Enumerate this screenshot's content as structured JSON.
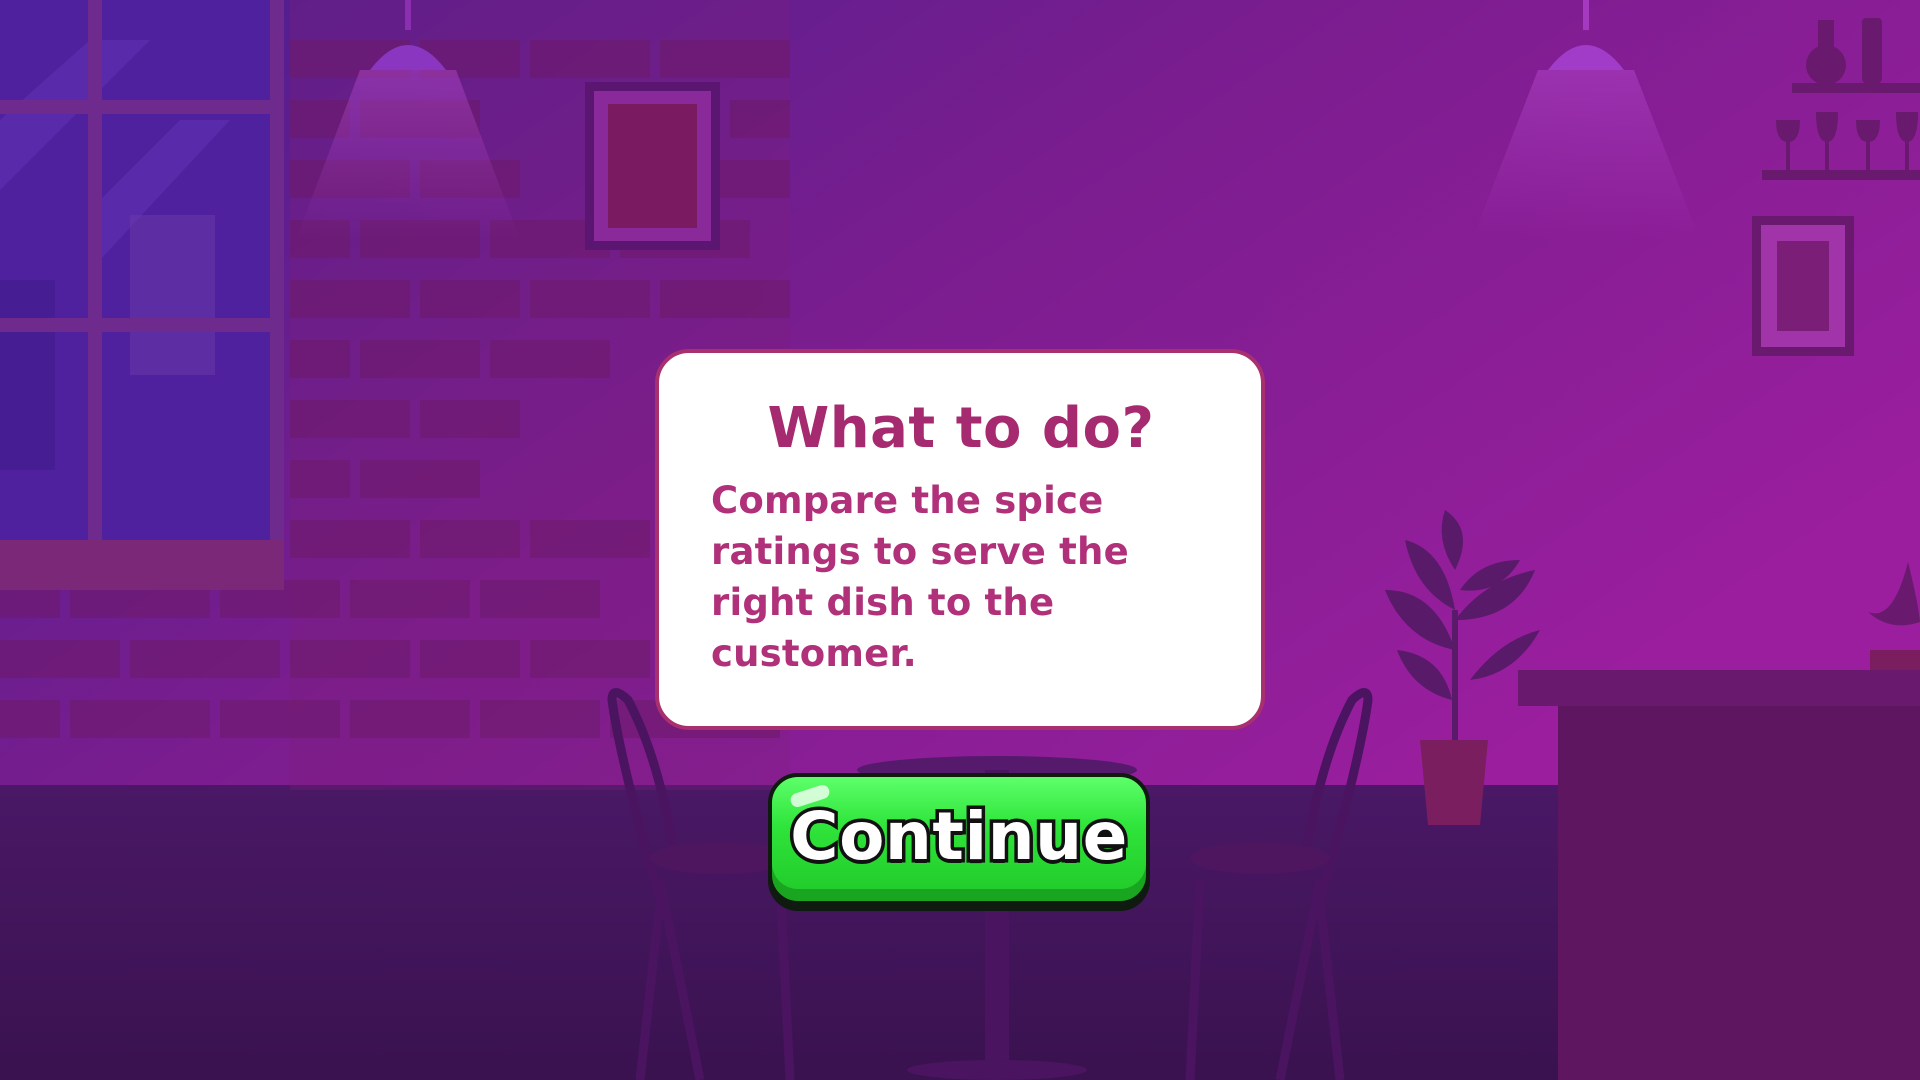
{
  "dialog": {
    "title": "What to do?",
    "body": "Compare the spice ratings to serve the right dish to the customer."
  },
  "continue_button": {
    "label": "Continue"
  },
  "colors": {
    "background_top": "#8a1f99",
    "background_bottom": "#3a124f",
    "card_border": "#a8306f",
    "title_text": "#a52a6f",
    "body_text": "#b0307a",
    "button_green": "#2fe43a",
    "button_outline": "#0e1b0e"
  },
  "icons": {
    "scene": "restaurant-interior-background"
  }
}
